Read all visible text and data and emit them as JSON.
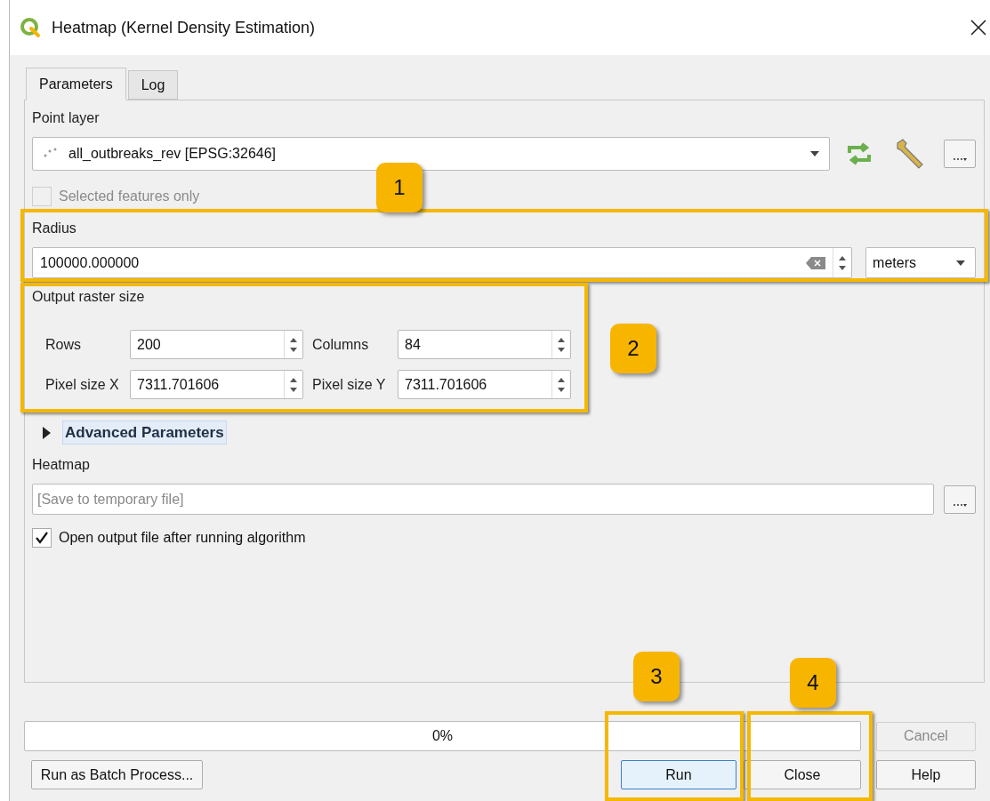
{
  "window": {
    "title": "Heatmap (Kernel Density Estimation)"
  },
  "tabs": [
    {
      "label": "Parameters",
      "selected": true
    },
    {
      "label": "Log",
      "selected": false
    }
  ],
  "point_layer": {
    "label": "Point layer",
    "value": "all_outbreaks_rev [EPSG:32646]"
  },
  "selected_features_only": {
    "label": "Selected features only",
    "checked": false,
    "disabled": true
  },
  "radius": {
    "label": "Radius",
    "value": "100000.000000",
    "unit": "meters"
  },
  "output_raster_size": {
    "label": "Output raster size",
    "fields": [
      {
        "label": "Rows",
        "value": "200"
      },
      {
        "label": "Columns",
        "value": "84"
      },
      {
        "label": "Pixel size X",
        "value": "7311.701606"
      },
      {
        "label": "Pixel size Y",
        "value": "7311.701606"
      }
    ]
  },
  "advanced_parameters": {
    "label": "Advanced Parameters",
    "expanded": false
  },
  "heatmap": {
    "label": "Heatmap",
    "placeholder": "[Save to temporary file]"
  },
  "open_output": {
    "label": "Open output file after running algorithm",
    "checked": true
  },
  "progress": {
    "label": "0%",
    "level": 0
  },
  "cancel_button": {
    "label": "Cancel",
    "disabled": true
  },
  "buttons": [
    {
      "label": "Run as Batch Process...",
      "focused": false
    },
    {
      "label": "Run",
      "focused": true
    },
    {
      "label": "Close",
      "focused": false
    },
    {
      "label": "Help",
      "focused": false
    }
  ],
  "annotations": [
    {
      "label": "1"
    },
    {
      "label": "2"
    },
    {
      "label": "3"
    },
    {
      "label": "4"
    }
  ]
}
